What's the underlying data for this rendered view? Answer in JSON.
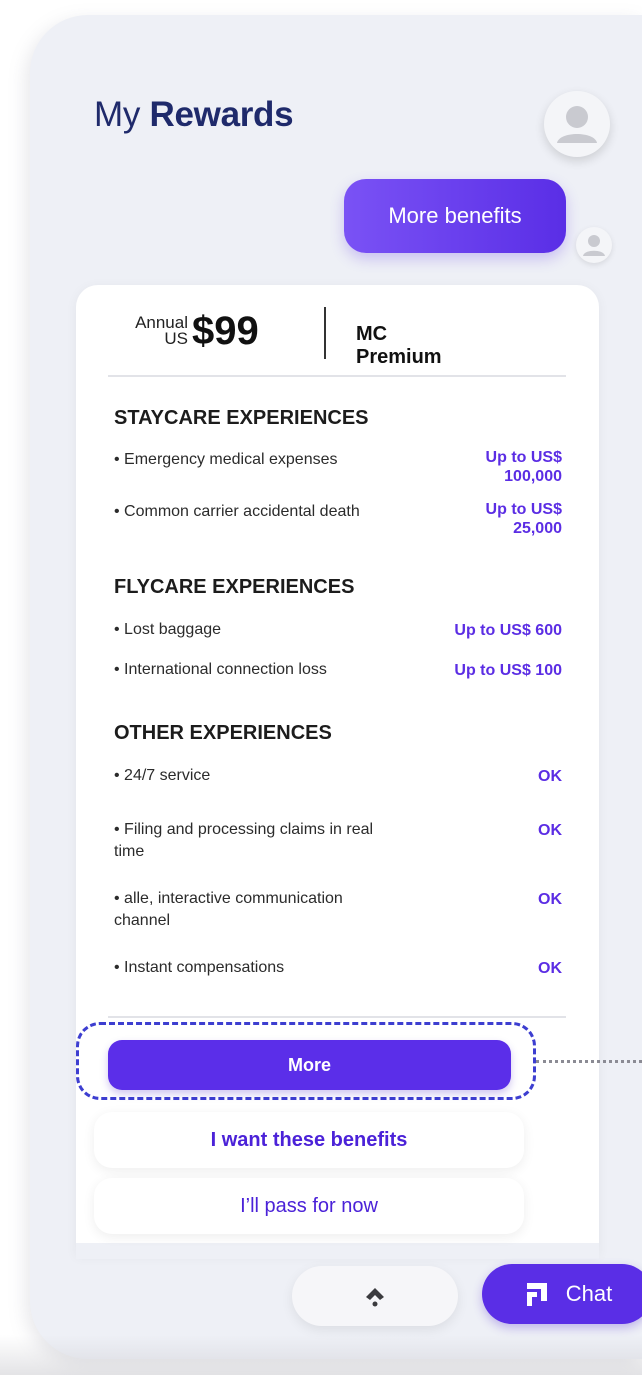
{
  "header": {
    "title_prefix": "My",
    "title_emphasis": "Rewards"
  },
  "benefits_pill": {
    "label": "More benefits"
  },
  "plan": {
    "annual_label": "Annual",
    "currency": "US",
    "price": "$99",
    "name": "MC Premium"
  },
  "sections": [
    {
      "title": "STAYCARE EXPERIENCES",
      "items": [
        {
          "label": "Emergency medical expenses",
          "value_line1": "Up to US$",
          "value_line2": "100,000"
        },
        {
          "label": "Common carrier accidental death",
          "value_line1": "Up to US$",
          "value_line2": "25,000"
        }
      ]
    },
    {
      "title": "FLYCARE EXPERIENCES",
      "items": [
        {
          "label": "Lost baggage",
          "value": "Up to US$ 600"
        },
        {
          "label": "International connection loss",
          "value": "Up to US$ 100"
        }
      ]
    },
    {
      "title": "OTHER EXPERIENCES",
      "items": [
        {
          "label": "24/7 service",
          "value": "OK"
        },
        {
          "label": "Filing and processing claims in real time",
          "value": "OK"
        },
        {
          "label": "alle, interactive communication channel",
          "value": "OK"
        },
        {
          "label": "Instant compensations",
          "value": "OK"
        }
      ]
    }
  ],
  "actions": {
    "more": "More",
    "want": "I want these benefits",
    "pass": "I’ll pass for now"
  },
  "bottom_bar": {
    "scroll_icon": "chevron-up-icon",
    "chat_icon": "chat-icon",
    "chat_label": "Chat"
  },
  "colors": {
    "accent": "#5a2ee6",
    "title": "#1f2a6b",
    "background": "#eef0f6"
  }
}
